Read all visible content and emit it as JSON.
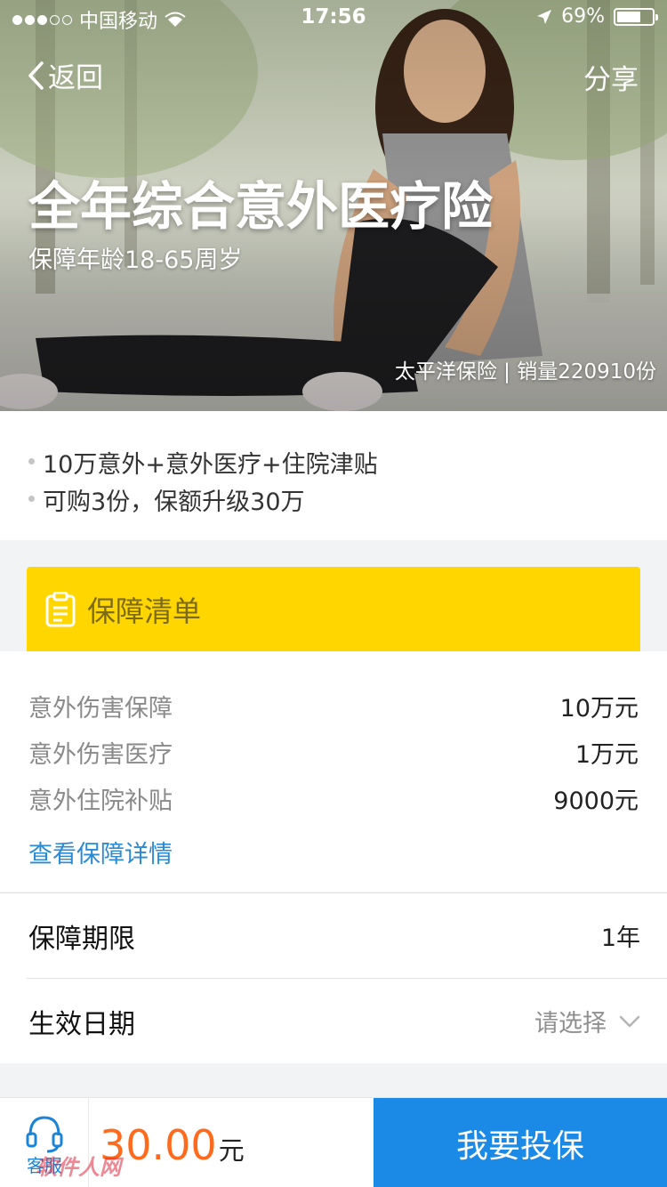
{
  "status_bar": {
    "carrier": "中国移动",
    "time": "17:56",
    "battery": "69%",
    "battery_level": 0.69
  },
  "nav": {
    "back_label": "返回",
    "share_label": "分享"
  },
  "hero": {
    "title": "全年综合意外医疗险",
    "subtitle": "保障年龄18-65周岁",
    "meta": "太平洋保险 | 销量220910份"
  },
  "highlights": [
    "10万意外+意外医疗+住院津贴",
    "可购3份，保额升级30万"
  ],
  "coverage": {
    "header": "保障清单",
    "items": [
      {
        "label": "意外伤害保障",
        "value": "10万元"
      },
      {
        "label": "意外伤害医疗",
        "value": "1万元"
      },
      {
        "label": "意外住院补贴",
        "value": "9000元"
      }
    ],
    "detail_link": "查看保障详情"
  },
  "term": {
    "period_label": "保障期限",
    "period_value": "1年",
    "date_label": "生效日期",
    "date_placeholder": "请选择"
  },
  "bottom": {
    "service_label": "客服",
    "price": "30.00",
    "price_unit": "元",
    "buy_label": "我要投保",
    "watermark": "软件人网"
  },
  "colors": {
    "accent_yellow": "#ffd600",
    "price_orange": "#ff6a1c",
    "primary_blue": "#1a8ae6",
    "link_blue": "#2a8ad6"
  }
}
